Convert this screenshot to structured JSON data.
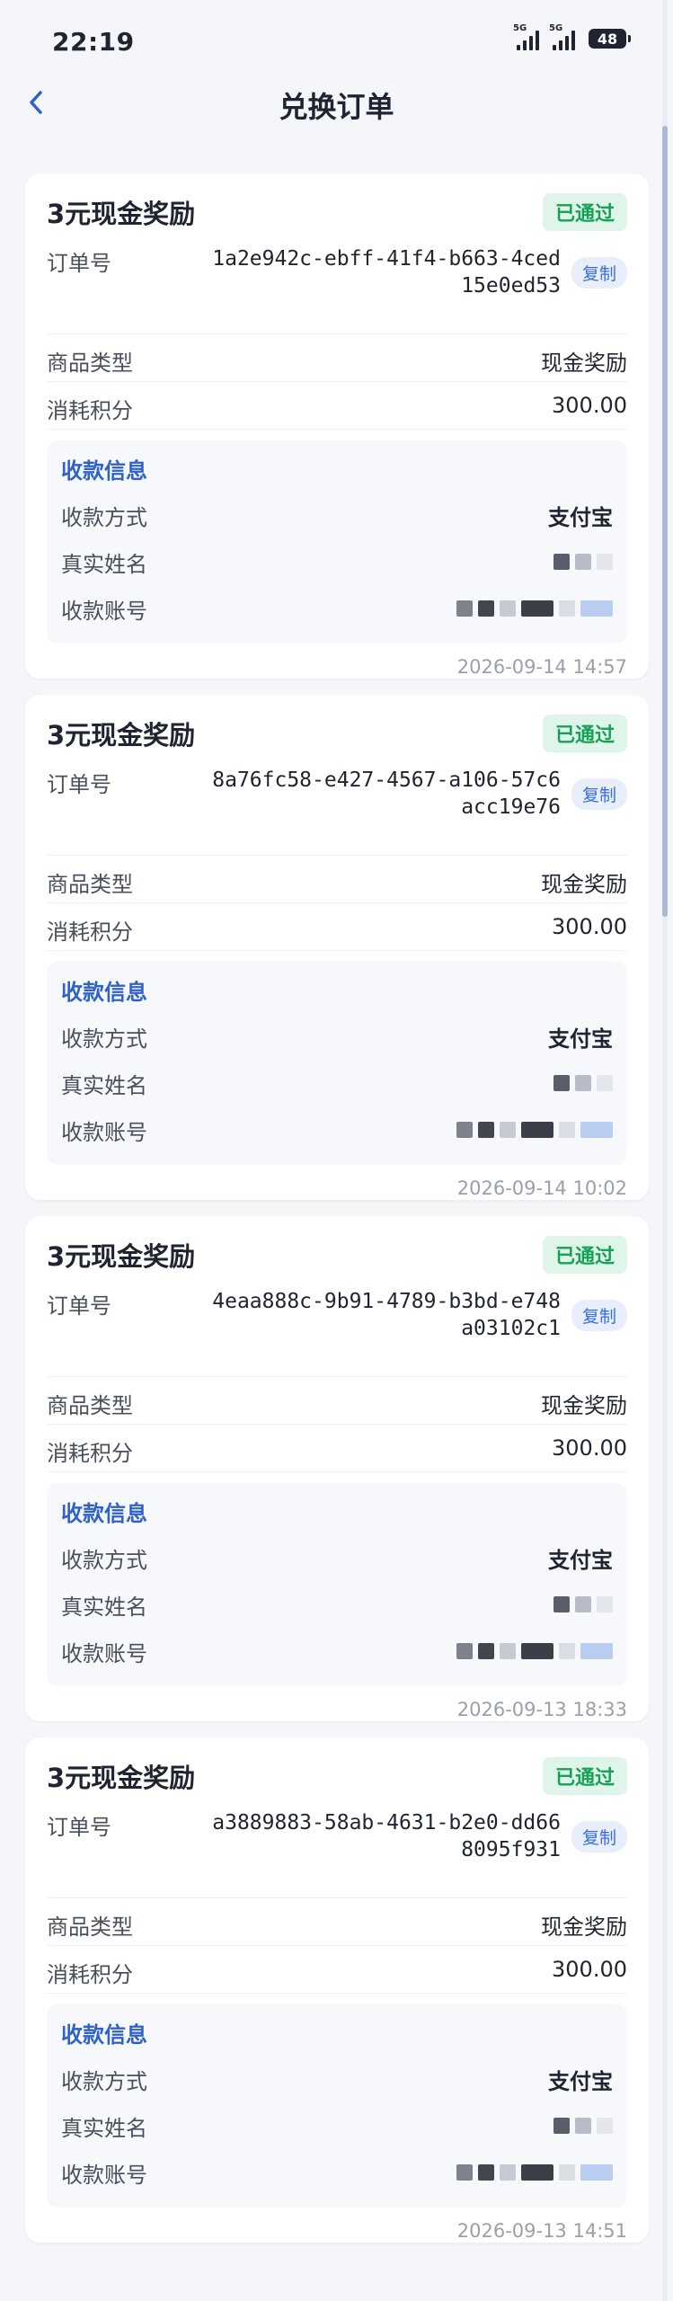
{
  "status_bar": {
    "time": "22:19",
    "signal_1": "5G",
    "signal_2": "5G",
    "battery": "48"
  },
  "nav": {
    "title": "兑换订单"
  },
  "labels": {
    "order_no": "订单号",
    "product_type": "商品类型",
    "points": "消耗积分",
    "pay_title": "收款信息",
    "pay_method": "收款方式",
    "real_name": "真实姓名",
    "account": "收款账号",
    "copy": "复制"
  },
  "orders": [
    {
      "title": "3元现金奖励",
      "status": "已通过",
      "order_id": "1a2e942c-ebff-41f4-b663-4ced15e0ed53",
      "product_type": "现金奖励",
      "points": "300.00",
      "pay_method": "支付宝",
      "time": "2026-09-14 14:57"
    },
    {
      "title": "3元现金奖励",
      "status": "已通过",
      "order_id": "8a76fc58-e427-4567-a106-57c6acc19e76",
      "product_type": "现金奖励",
      "points": "300.00",
      "pay_method": "支付宝",
      "time": "2026-09-14 10:02"
    },
    {
      "title": "3元现金奖励",
      "status": "已通过",
      "order_id": "4eaa888c-9b91-4789-b3bd-e748a03102c1",
      "product_type": "现金奖励",
      "points": "300.00",
      "pay_method": "支付宝",
      "time": "2026-09-13 18:33"
    },
    {
      "title": "3元现金奖励",
      "status": "已通过",
      "order_id": "a3889883-58ab-4631-b2e0-dd668095f931",
      "product_type": "现金奖励",
      "points": "300.00",
      "pay_method": "支付宝",
      "time": "2026-09-13 14:51"
    }
  ],
  "colors": {
    "accent": "#2f62c8",
    "status_green": "#18a058",
    "status_bg": "#dff5e9"
  },
  "icons": {
    "back": "chevron-left-icon"
  }
}
